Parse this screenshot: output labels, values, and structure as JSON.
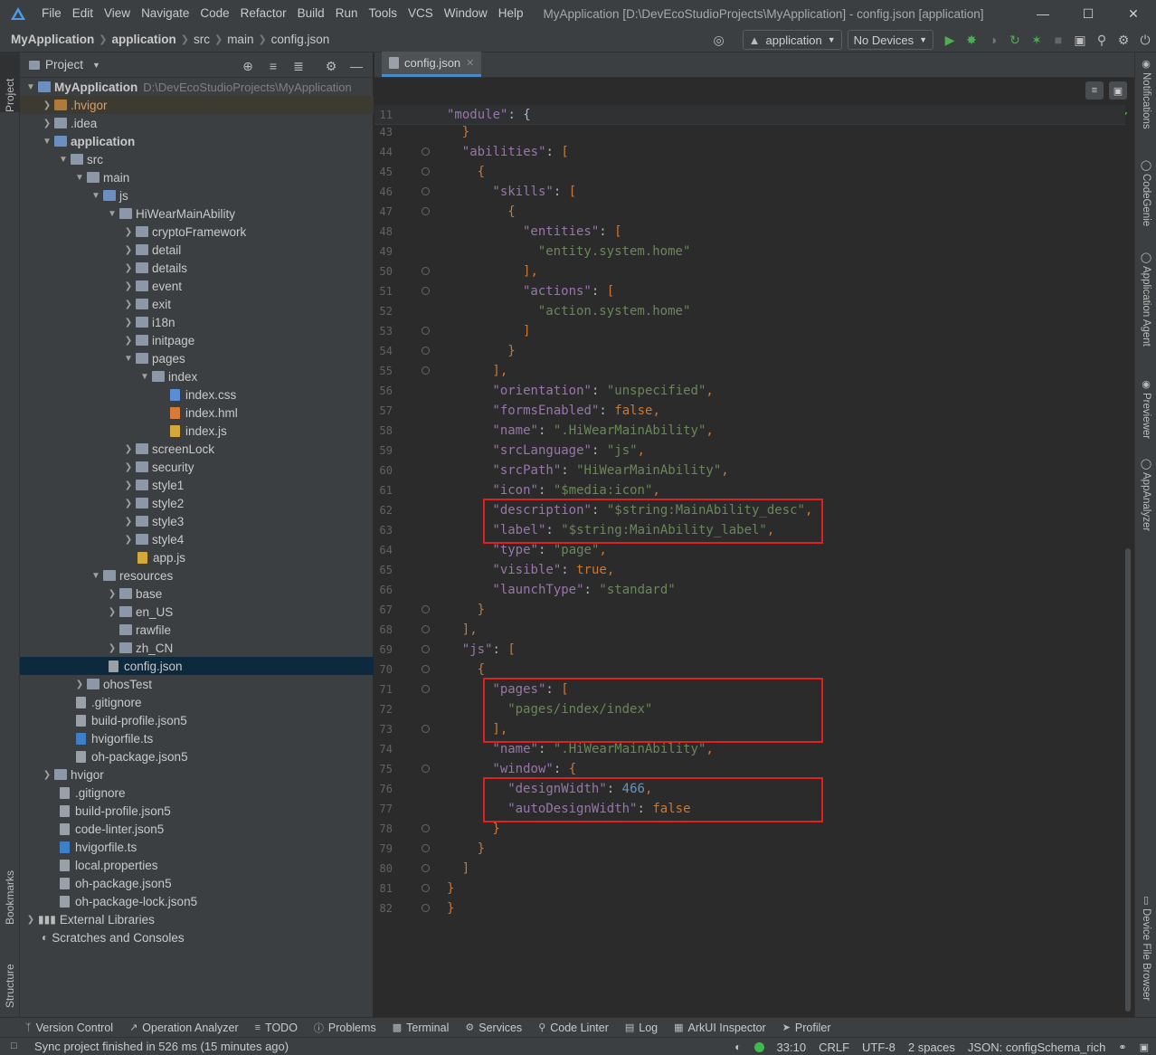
{
  "app": {
    "menu": [
      "File",
      "Edit",
      "View",
      "Navigate",
      "Code",
      "Refactor",
      "Build",
      "Run",
      "Tools",
      "VCS",
      "Window",
      "Help"
    ],
    "window_title": "MyApplication [D:\\DevEcoStudioProjects\\MyApplication] - config.json [application]"
  },
  "breadcrumb": [
    "MyApplication",
    "application",
    "src",
    "main",
    "config.json"
  ],
  "toolbar": {
    "module_select": "application",
    "device_select": "No Devices"
  },
  "left_strip": {
    "project_tab": "Project",
    "bookmarks_tab": "Bookmarks",
    "structure_tab": "Structure"
  },
  "right_strip": [
    "Notifications",
    "CodeGenie",
    "Application Agent",
    "Previewer",
    "AppAnalyzer",
    "Device File Browser"
  ],
  "project_panel": {
    "title": "Project",
    "tree": [
      {
        "label": "MyApplication",
        "path": "D:\\DevEcoStudioProjects\\MyApplication"
      },
      {
        "label": ".hvigor"
      },
      {
        "label": ".idea"
      },
      {
        "label": "application"
      },
      {
        "label": "src"
      },
      {
        "label": "main"
      },
      {
        "label": "js"
      },
      {
        "label": "HiWearMainAbility"
      },
      {
        "label": "cryptoFramework"
      },
      {
        "label": "detail"
      },
      {
        "label": "details"
      },
      {
        "label": "event"
      },
      {
        "label": "exit"
      },
      {
        "label": "i18n"
      },
      {
        "label": "initpage"
      },
      {
        "label": "pages"
      },
      {
        "label": "index"
      },
      {
        "label": "index.css"
      },
      {
        "label": "index.hml"
      },
      {
        "label": "index.js"
      },
      {
        "label": "screenLock"
      },
      {
        "label": "security"
      },
      {
        "label": "style1"
      },
      {
        "label": "style2"
      },
      {
        "label": "style3"
      },
      {
        "label": "style4"
      },
      {
        "label": "app.js"
      },
      {
        "label": "resources"
      },
      {
        "label": "base"
      },
      {
        "label": "en_US"
      },
      {
        "label": "rawfile"
      },
      {
        "label": "zh_CN"
      },
      {
        "label": "config.json"
      },
      {
        "label": "ohosTest"
      },
      {
        "label": ".gitignore"
      },
      {
        "label": "build-profile.json5"
      },
      {
        "label": "hvigorfile.ts"
      },
      {
        "label": "oh-package.json5"
      },
      {
        "label": "hvigor"
      },
      {
        "label": ".gitignore"
      },
      {
        "label": "build-profile.json5"
      },
      {
        "label": "code-linter.json5"
      },
      {
        "label": "hvigorfile.ts"
      },
      {
        "label": "local.properties"
      },
      {
        "label": "oh-package.json5"
      },
      {
        "label": "oh-package-lock.json5"
      },
      {
        "label": "External Libraries"
      },
      {
        "label": "Scratches and Consoles"
      }
    ]
  },
  "editor": {
    "tab": "config.json",
    "sticky": {
      "ln": "11",
      "key": "\"module\"",
      "rest": ": {"
    },
    "lines": [
      {
        "ln": "43",
        "t": "}"
      },
      {
        "ln": "44",
        "t": "\"abilities\": ["
      },
      {
        "ln": "45",
        "t": "{"
      },
      {
        "ln": "46",
        "t": "\"skills\": ["
      },
      {
        "ln": "47",
        "t": "{"
      },
      {
        "ln": "48",
        "t": "\"entities\": ["
      },
      {
        "ln": "49",
        "t": "\"entity.system.home\""
      },
      {
        "ln": "50",
        "t": "],"
      },
      {
        "ln": "51",
        "t": "\"actions\": ["
      },
      {
        "ln": "52",
        "t": "\"action.system.home\""
      },
      {
        "ln": "53",
        "t": "]"
      },
      {
        "ln": "54",
        "t": "}"
      },
      {
        "ln": "55",
        "t": "],"
      },
      {
        "ln": "56",
        "t": "\"orientation\": \"unspecified\","
      },
      {
        "ln": "57",
        "t": "\"formsEnabled\": false,"
      },
      {
        "ln": "58",
        "t": "\"name\": \".HiWearMainAbility\","
      },
      {
        "ln": "59",
        "t": "\"srcLanguage\": \"js\","
      },
      {
        "ln": "60",
        "t": "\"srcPath\": \"HiWearMainAbility\","
      },
      {
        "ln": "61",
        "t": "\"icon\": \"$media:icon\","
      },
      {
        "ln": "62",
        "t": "\"description\": \"$string:MainAbility_desc\","
      },
      {
        "ln": "63",
        "t": "\"label\": \"$string:MainAbility_label\","
      },
      {
        "ln": "64",
        "t": "\"type\": \"page\","
      },
      {
        "ln": "65",
        "t": "\"visible\": true,"
      },
      {
        "ln": "66",
        "t": "\"launchType\": \"standard\""
      },
      {
        "ln": "67",
        "t": "}"
      },
      {
        "ln": "68",
        "t": "],"
      },
      {
        "ln": "69",
        "t": "\"js\": ["
      },
      {
        "ln": "70",
        "t": "{"
      },
      {
        "ln": "71",
        "t": "\"pages\": ["
      },
      {
        "ln": "72",
        "t": "\"pages/index/index\""
      },
      {
        "ln": "73",
        "t": "],"
      },
      {
        "ln": "74",
        "t": "\"name\": \".HiWearMainAbility\","
      },
      {
        "ln": "75",
        "t": "\"window\": {"
      },
      {
        "ln": "76",
        "t": "\"designWidth\": 466,"
      },
      {
        "ln": "77",
        "t": "\"autoDesignWidth\": false"
      },
      {
        "ln": "78",
        "t": "}"
      },
      {
        "ln": "79",
        "t": "}"
      },
      {
        "ln": "80",
        "t": "]"
      },
      {
        "ln": "81",
        "t": "}"
      },
      {
        "ln": "82",
        "t": "}"
      }
    ]
  },
  "bottom_tools": [
    "Version Control",
    "Operation Analyzer",
    "TODO",
    "Problems",
    "Terminal",
    "Services",
    "Code Linter",
    "Log",
    "ArkUI Inspector",
    "Profiler"
  ],
  "status": {
    "message": "Sync project finished in 526 ms (15 minutes ago)",
    "position": "33:10",
    "line_sep": "CRLF",
    "encoding": "UTF-8",
    "indent": "2 spaces",
    "schema": "JSON: configSchema_rich"
  },
  "colors": {
    "accent": "#4a88c7",
    "highlight_box": "#e0201f",
    "key": "#9876aa",
    "string": "#6a8759",
    "number": "#6897bb",
    "keyword": "#cc7832"
  }
}
